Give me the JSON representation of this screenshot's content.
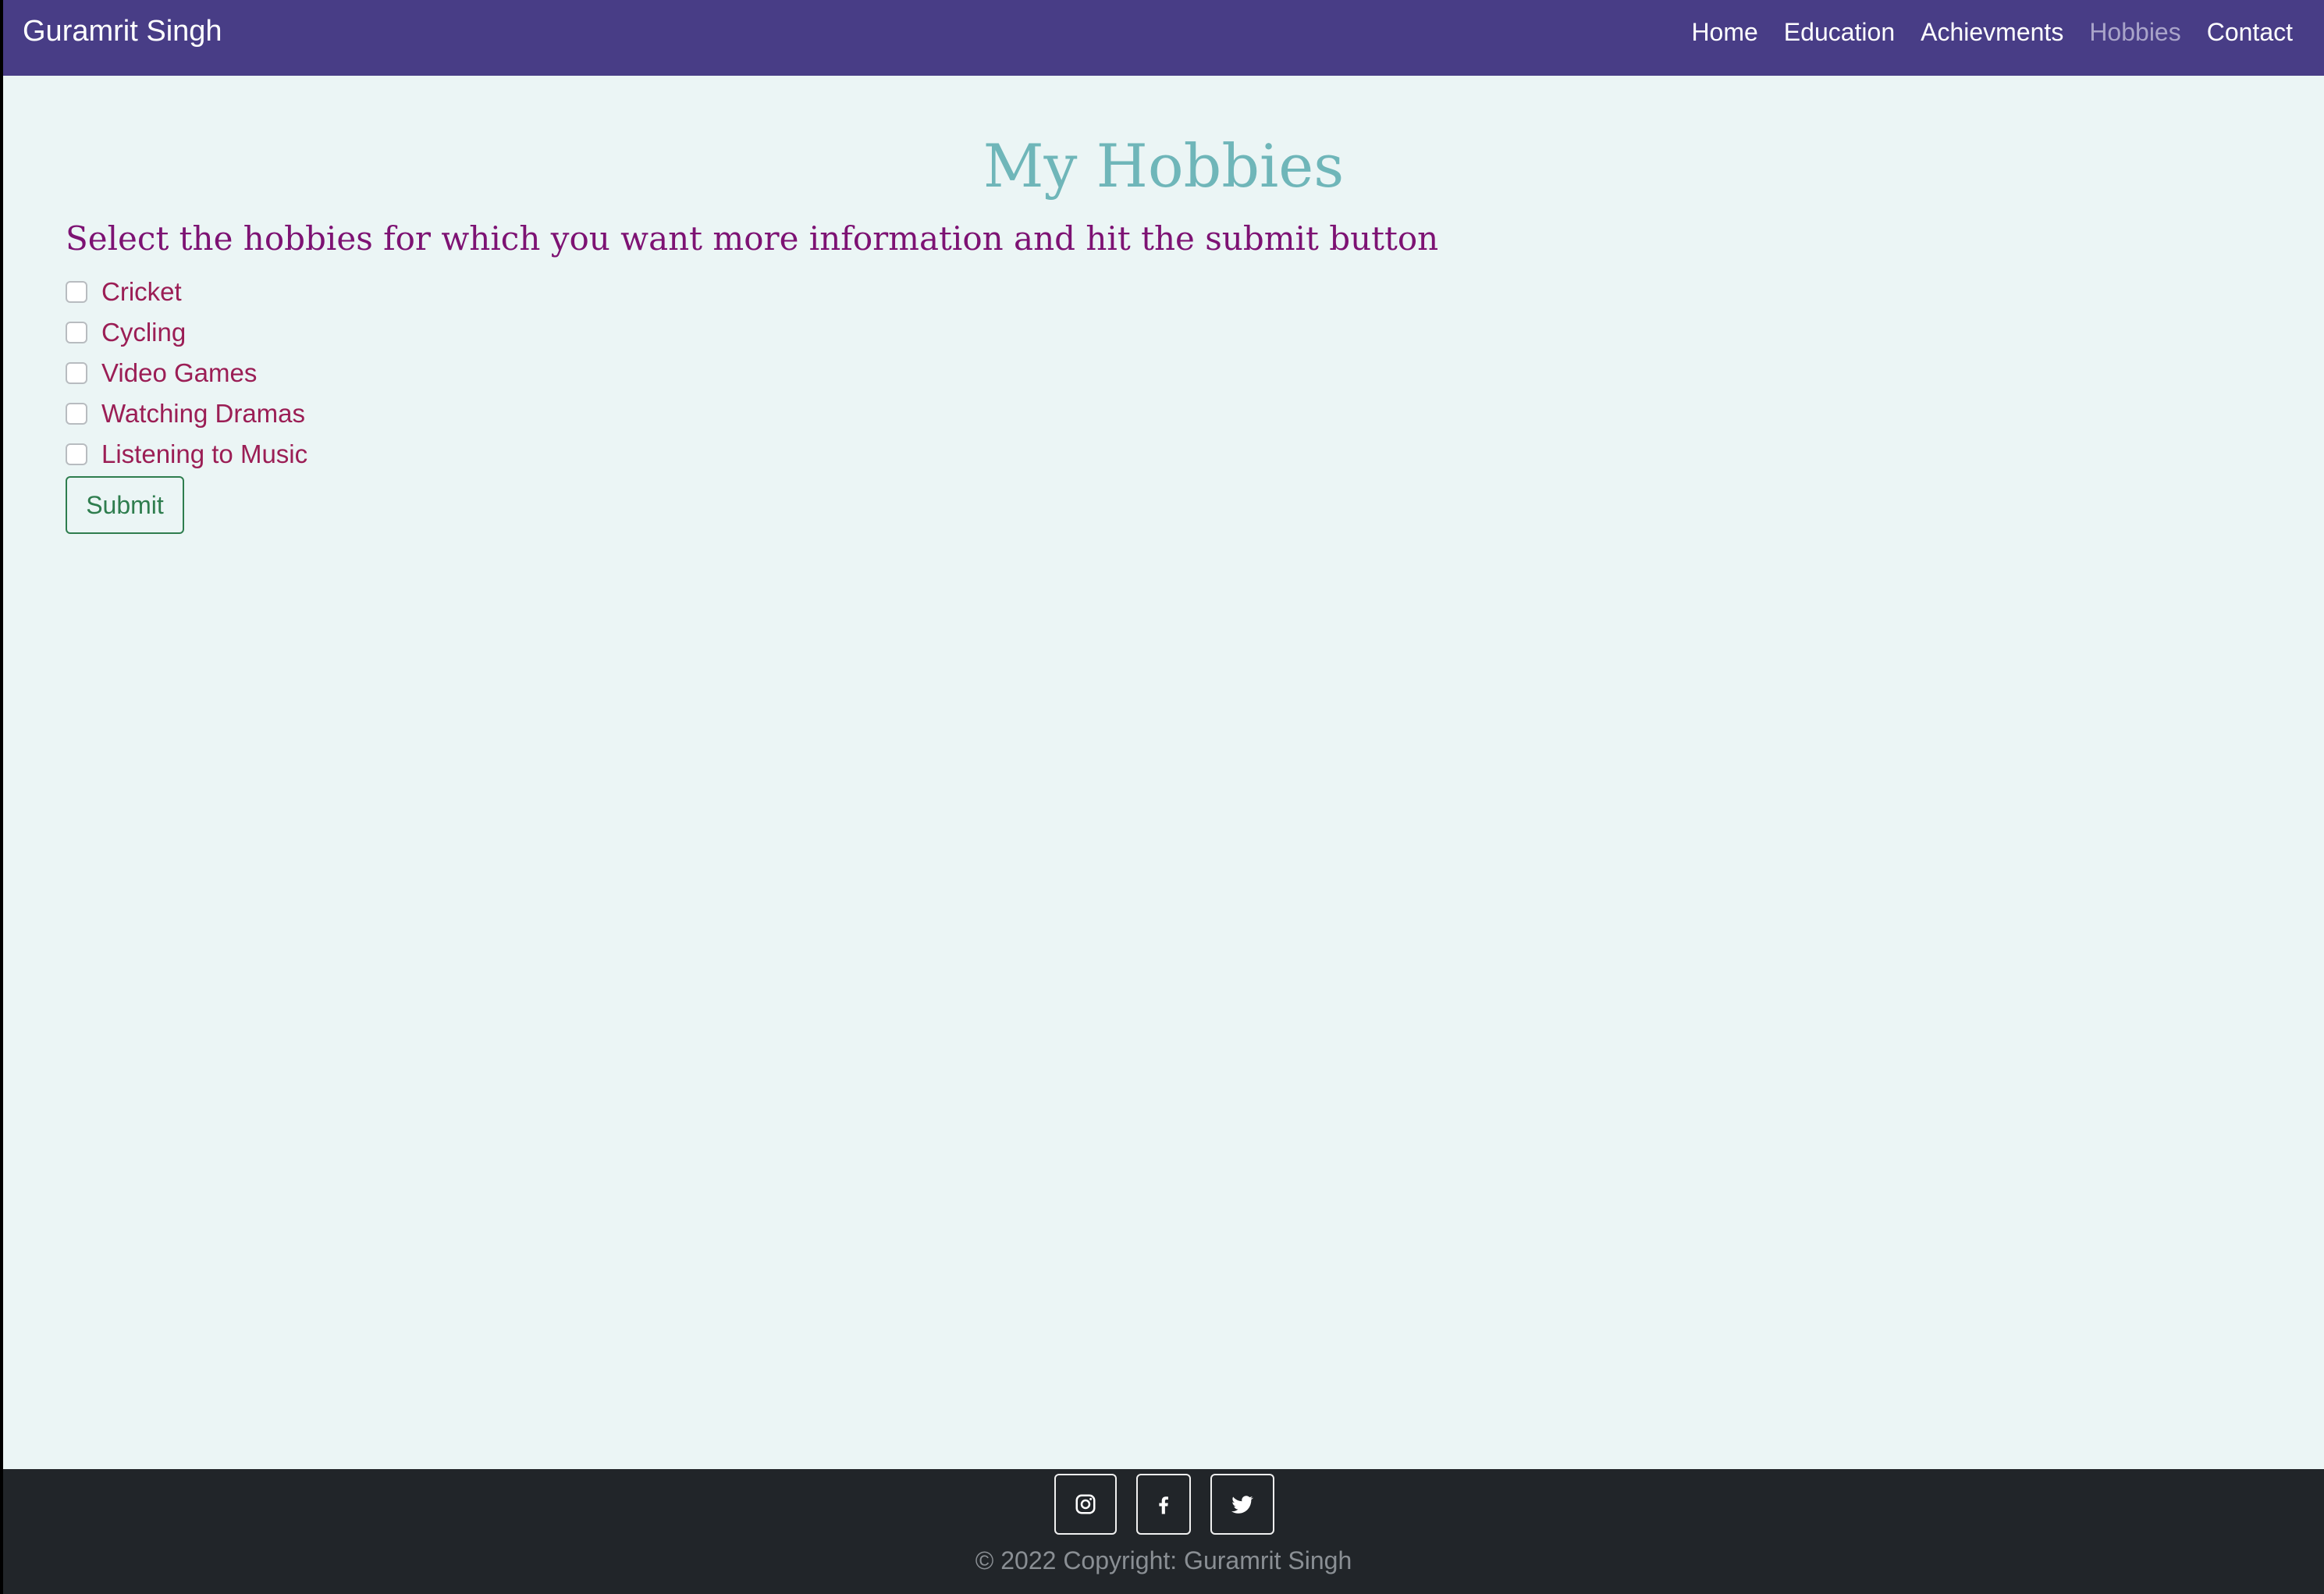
{
  "navbar": {
    "brand": "Guramrit Singh",
    "links": [
      {
        "label": "Home",
        "active": false
      },
      {
        "label": "Education",
        "active": false
      },
      {
        "label": "Achievments",
        "active": false
      },
      {
        "label": "Hobbies",
        "active": true
      },
      {
        "label": "Contact",
        "active": false
      }
    ]
  },
  "main": {
    "title": "My Hobbies",
    "subtitle": "Select the hobbies for which you want more information and hit the submit button",
    "hobbies": [
      {
        "label": "Cricket",
        "checked": false
      },
      {
        "label": "Cycling",
        "checked": false
      },
      {
        "label": "Video Games",
        "checked": false
      },
      {
        "label": "Watching Dramas",
        "checked": false
      },
      {
        "label": "Listening to Music",
        "checked": false
      }
    ],
    "submit_label": "Submit"
  },
  "footer": {
    "social": [
      {
        "icon": "instagram-icon"
      },
      {
        "icon": "facebook-icon"
      },
      {
        "icon": "twitter-icon"
      }
    ],
    "copyright": "© 2022 Copyright: Guramrit Singh"
  },
  "colors": {
    "navbar_bg": "#483d86",
    "page_bg": "#ebf5f5",
    "title": "#6fb6b9",
    "subtitle": "#7d1273",
    "checkbox_label": "#9b1e55",
    "submit": "#2e7d4e",
    "footer_bg": "#212529"
  }
}
